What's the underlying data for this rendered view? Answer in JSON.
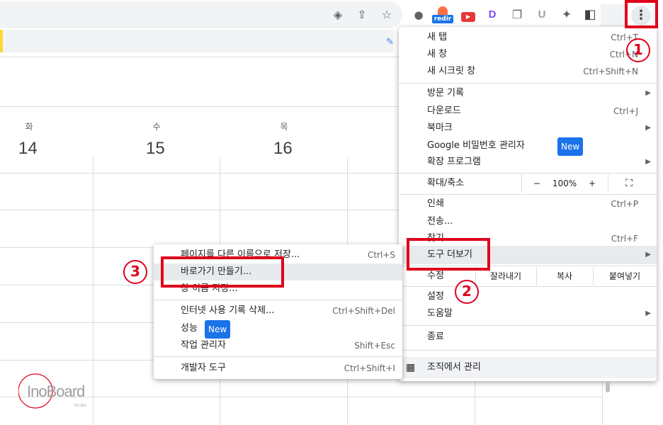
{
  "toolbar": {
    "icons": [
      "diamond-icon",
      "share-icon",
      "star-icon"
    ],
    "extensions": [
      {
        "name": "robot-extension-icon",
        "glyph": "●",
        "color": "#5f6368"
      },
      {
        "name": "redir-extension-icon",
        "label": "redir",
        "color": "#1a73e8"
      },
      {
        "name": "youtube-extension-icon",
        "glyph": "▶",
        "color": "#e53935"
      },
      {
        "name": "d-extension-icon",
        "glyph": "D",
        "color": "#7c4dff"
      },
      {
        "name": "copy-extension-icon",
        "glyph": "❐",
        "color": "#5f6368"
      },
      {
        "name": "u-extension-icon",
        "glyph": "U",
        "color": "#9aa0a6"
      },
      {
        "name": "puzzle-icon",
        "glyph": "✦",
        "color": "#5f6368"
      },
      {
        "name": "sidepanel-icon",
        "glyph": "◧",
        "color": "#5f6368"
      }
    ],
    "menu_glyph": "⋮"
  },
  "calendar": {
    "days": [
      {
        "name": "화",
        "num": "14"
      },
      {
        "name": "수",
        "num": "15"
      },
      {
        "name": "목",
        "num": "16"
      }
    ]
  },
  "main_menu": {
    "new_tab": {
      "label": "새 탭",
      "shortcut": "Ctrl+T"
    },
    "new_window": {
      "label": "새 창",
      "shortcut": "Ctrl+N"
    },
    "incognito": {
      "label": "새 시크릿 창",
      "shortcut": "Ctrl+Shift+N"
    },
    "history": {
      "label": "방문 기록"
    },
    "downloads": {
      "label": "다운로드",
      "shortcut": "Ctrl+J"
    },
    "bookmarks": {
      "label": "북마크"
    },
    "passwords": {
      "label": "Google 비밀번호 관리자",
      "badge": "New"
    },
    "extensions": {
      "label": "확장 프로그램"
    },
    "zoom": {
      "label": "확대/축소",
      "minus": "−",
      "value": "100%",
      "plus": "+",
      "fullscreen": "⛶"
    },
    "print": {
      "label": "인쇄",
      "shortcut": "Ctrl+P"
    },
    "cast": {
      "label": "전송..."
    },
    "find": {
      "label": "찾기...",
      "shortcut": "Ctrl+F"
    },
    "more_tools": {
      "label": "도구 더보기"
    },
    "edit": {
      "label": "수정",
      "cut": "잘라내기",
      "copy": "복사",
      "paste": "붙여넣기"
    },
    "settings": {
      "label": "설정"
    },
    "help": {
      "label": "도움말"
    },
    "exit": {
      "label": "종료"
    },
    "managed": {
      "label": "조직에서 관리"
    }
  },
  "sub_menu": {
    "save_page": {
      "label": "페이지를 다른 이름으로 저장...",
      "shortcut": "Ctrl+S"
    },
    "create_shortcut": {
      "label": "바로가기 만들기..."
    },
    "name_window": {
      "label": "창 이름 지정..."
    },
    "clear_data": {
      "label": "인터넷 사용 기록 삭제...",
      "shortcut": "Ctrl+Shift+Del"
    },
    "performance": {
      "label": "성능",
      "badge": "New"
    },
    "task_manager": {
      "label": "작업 관리자",
      "shortcut": "Shift+Esc"
    },
    "dev_tools": {
      "label": "개발자 도구",
      "shortcut": "Ctrl+Shift+I"
    }
  },
  "annotations": {
    "step1": "1",
    "step2": "2",
    "step3": "3"
  },
  "watermark": {
    "brand": "InoBoard",
    "sub": "이노보드"
  },
  "colors": {
    "annotation_red": "#e0001b",
    "badge_blue": "#1a73e8",
    "highlight": "#e8eaed"
  }
}
